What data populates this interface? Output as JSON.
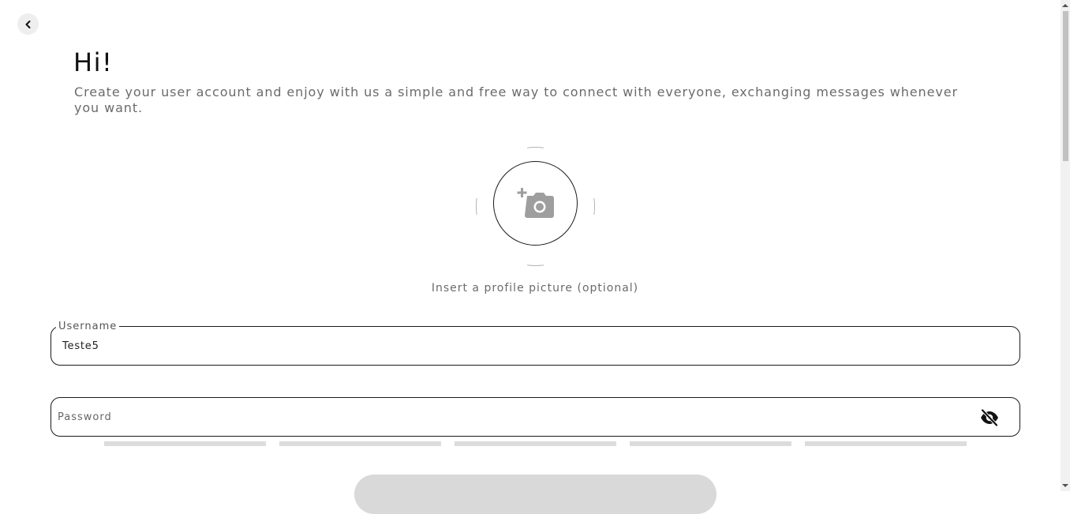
{
  "header": {
    "back_icon": "chevron-left-icon",
    "title": "Hi!",
    "subtitle": "Create your user account and enjoy with us a simple and free way to connect with everyone, exchanging messages whenever you want."
  },
  "avatar": {
    "icon": "add-photo-icon",
    "caption": "Insert a profile picture (optional)"
  },
  "form": {
    "username": {
      "label": "Username",
      "value": "Teste5"
    },
    "password": {
      "placeholder": "Password",
      "value": "",
      "toggle_icon": "eye-off-icon"
    },
    "password_strength": {
      "segments": 5,
      "filled": 0
    },
    "submit": {
      "label": ""
    }
  },
  "colors": {
    "background": "#ffffff",
    "text": "#1a1a1a",
    "muted": "#6b6b6b",
    "strength_empty": "#dcdcdc",
    "button_disabled": "#d9d9d9"
  }
}
